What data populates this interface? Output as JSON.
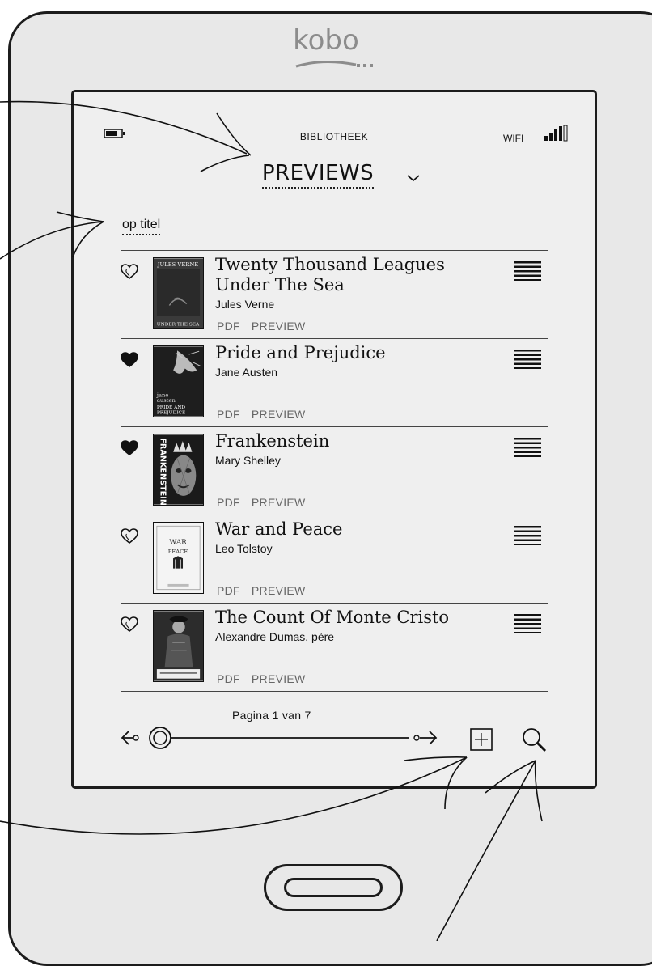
{
  "device": {
    "brand_logo": "kobo"
  },
  "status_bar": {
    "battery_icon": "battery-icon",
    "title": "BIBLIOTHEEK",
    "wifi_label": "WIFI",
    "signal_icon": "signal-bars-icon"
  },
  "header": {
    "collection_title": "PREVIEWS",
    "collection_menu_icon": "chevron-down-icon",
    "sort_label": "op titel"
  },
  "books": [
    {
      "title_line1": "Twenty Thousand Leagues",
      "title_line2": "Under The Sea",
      "author": "Jules Verne",
      "format": "PDF",
      "status": "PREVIEW",
      "favorite": false,
      "cover_text": "JULES VERNE / UNDER THE SEA"
    },
    {
      "title_line1": "Pride and Prejudice",
      "title_line2": "",
      "author": "Jane Austen",
      "format": "PDF",
      "status": "PREVIEW",
      "favorite": true,
      "cover_text": "jane austen PRIDE AND PREJUDICE"
    },
    {
      "title_line1": "Frankenstein",
      "title_line2": "",
      "author": "Mary Shelley",
      "format": "PDF",
      "status": "PREVIEW",
      "favorite": true,
      "cover_text": "FRANKENSTEIN"
    },
    {
      "title_line1": "War and Peace",
      "title_line2": "",
      "author": "Leo Tolstoy",
      "format": "PDF",
      "status": "PREVIEW",
      "favorite": false,
      "cover_text": "WAR PEACE"
    },
    {
      "title_line1": "The Count Of Monte Cristo",
      "title_line2": "",
      "author": "Alexandre Dumas, père",
      "format": "PDF",
      "status": "PREVIEW",
      "favorite": false,
      "cover_text": ""
    }
  ],
  "footer": {
    "page_label": "Pagina 1 van 7",
    "current_page": 1,
    "total_pages": 7,
    "prev_icon": "arrow-left-icon",
    "next_icon": "arrow-right-icon",
    "grid_icon": "grid-view-icon",
    "search_icon": "search-icon"
  },
  "colors": {
    "screen": "#efefef",
    "frame": "#e8e8e8",
    "ink": "#111111",
    "logo": "#8c8c8c"
  }
}
